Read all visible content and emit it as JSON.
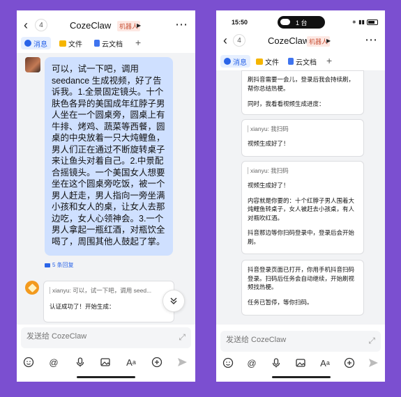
{
  "left": {
    "header": {
      "back_count": "4",
      "title": "CozeClaw",
      "badge": "机器人"
    },
    "tabs": {
      "messages": "消息",
      "files": "文件",
      "cloud_docs": "云文档"
    },
    "user_message": "可以，试一下吧，调用seedance 生成视频，好了告诉我。1.全景固定镜头。十个肤色各异的美国成年红脖子男人坐在一个圆桌旁，圆桌上有牛排、烤鸡、蔬菜等西餐，圆桌的中央放着一只大炖鲤鱼，男人们正在通过不断旋转桌子来让鱼头对着自己。2.中景配合摇镜头。一个美国女人想要坐在这个圆桌旁吃饭，被一个男人赶走，男人指向一旁坐满小孩和女人的桌，让女人去那边吃，女人心领神会。3.一个男人拿起一瓶红酒，对瓶饮全喝了，周围其他人鼓起了掌。",
    "replies": "5 条回复",
    "bot_quote": "xianyu: 可以，试一下吧，调用 seed...",
    "bot_text": "认证成功了！开始生成：",
    "input_placeholder": "发送给 CozeClaw"
  },
  "right": {
    "status": {
      "time": "15:50",
      "island_text": "1 台"
    },
    "header": {
      "back_count": "4",
      "title": "CozeClaw",
      "badge": "机器人"
    },
    "tabs": {
      "messages": "消息",
      "files": "文件",
      "cloud_docs": "云文档"
    },
    "card1": {
      "line1": "刷抖音需要一会儿，登录后我会持续刷，帮你总结热梗。",
      "line2": "同时，我看看视频生成进度："
    },
    "card2": {
      "quote": "xianyu: 我扫码",
      "text": "视频生成好了！"
    },
    "card3": {
      "quote": "xianyu: 我扫码",
      "p1": "视频生成好了！",
      "p2": "内容就是你要的：十个红脖子男人围着大炖鲤鱼转桌子，女人被赶去小孩桌，有人对瓶吹红酒。",
      "p3": "抖音那边等你扫码登录中，登录后会开始刷。"
    },
    "card4": {
      "p1": "抖音登录页面已打开，你用手机抖音扫码登录。扫码后任务会自动继续，开始刷视频找热梗。",
      "p2": "任务已暂停，等你扫码。"
    },
    "input_placeholder": "发送给 CozeClaw"
  }
}
